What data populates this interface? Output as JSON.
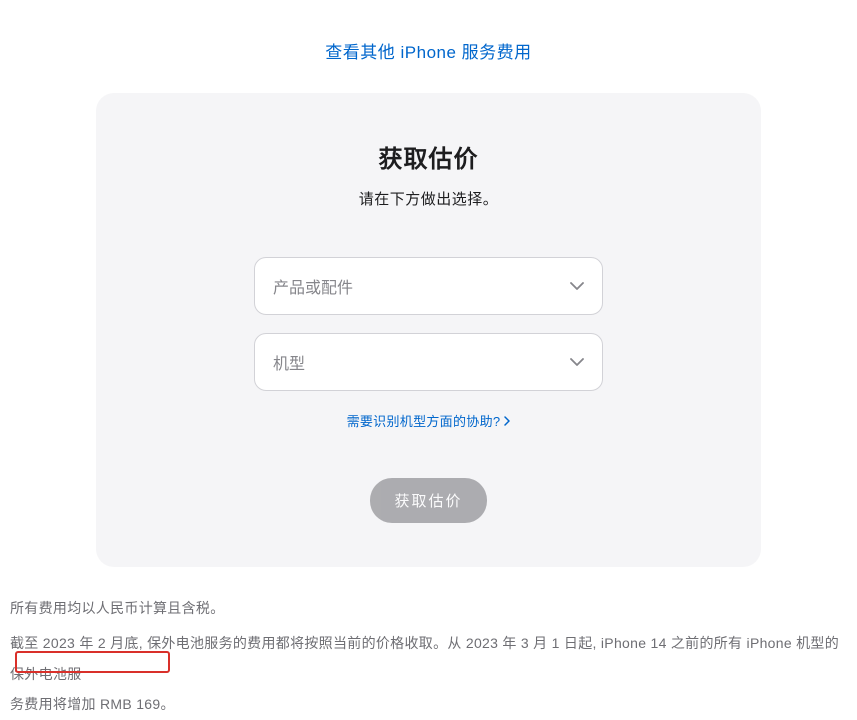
{
  "topLink": {
    "label": "查看其他 iPhone 服务费用"
  },
  "card": {
    "title": "获取估价",
    "subtitle": "请在下方做出选择。",
    "select1": {
      "placeholder": "产品或配件"
    },
    "select2": {
      "placeholder": "机型"
    },
    "helpLink": {
      "label": "需要识别机型方面的协助?"
    },
    "submit": {
      "label": "获取估价"
    }
  },
  "footer": {
    "line1": "所有费用均以人民币计算且含税。",
    "line2a": "截至 2023 年 2 月底, 保外电池服务的费用都将按照当前的价格收取。从 2023 年 3 月 1 日起, iPhone 14 之前的所有 iPhone 机型的保外电池服",
    "line2b": "务费用将增加 RMB 169。"
  }
}
